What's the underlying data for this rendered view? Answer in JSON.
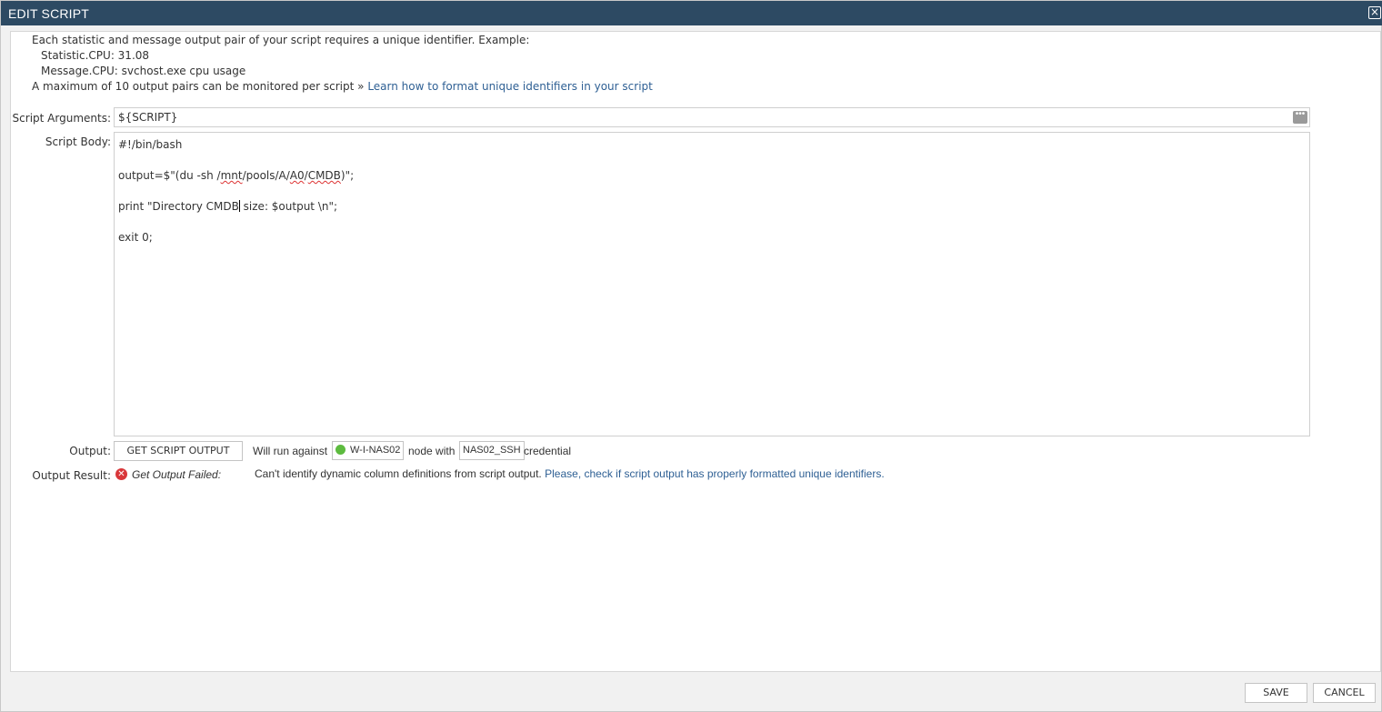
{
  "dialog": {
    "title": "EDIT SCRIPT",
    "close_icon": "close-icon"
  },
  "info": {
    "line1": "Each statistic and message output pair of your script requires a unique identifier. Example:",
    "line2": "Statistic.CPU: 31.08",
    "line3": "Message.CPU: svchost.exe cpu usage",
    "line4": "A maximum of 10 output pairs can be monitored per script »",
    "link": "Learn how to format unique identifiers in your script"
  },
  "args": {
    "label": "Script Arguments:",
    "value": "${SCRIPT}"
  },
  "body": {
    "label": "Script Body:",
    "lines": {
      "l1": "#!/bin/bash",
      "l2": "",
      "l3a": "output=$\"(du -sh /",
      "l3b": "mnt",
      "l3c": "/pools/A/",
      "l3d": "A0",
      "l3e": "/",
      "l3f": "CMDB",
      "l3g": ")\";",
      "l4": "",
      "l5a": "print \"Directory CMDB",
      "l5b": " size: $output \\n\";",
      "l6": "",
      "l7": "exit 0;"
    }
  },
  "output": {
    "label": "Output:",
    "button": "GET SCRIPT OUTPUT",
    "run_against": "Will run against",
    "node": "W-I-NAS02",
    "node_with": "node with",
    "credential_name": "NAS02_SSH",
    "credential_suffix": "credential",
    "node_status_color": "#5dbb3f"
  },
  "result": {
    "label": "Output Result:",
    "status": "Get Output Failed:",
    "message": "Can't identify dynamic column definitions from script output.",
    "link": "Please, check if script output has properly formatted unique identifiers."
  },
  "footer": {
    "save": "SAVE",
    "cancel": "CANCEL"
  },
  "colors": {
    "titlebar": "#2d4a63",
    "link": "#2f6094",
    "error": "#d9373a"
  }
}
